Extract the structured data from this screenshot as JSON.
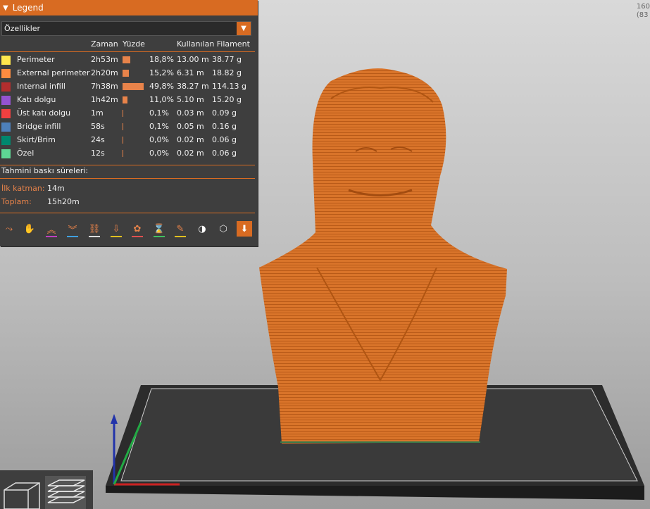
{
  "legend": {
    "title": "Legend",
    "view_select": "Özellikler",
    "columns": {
      "time": "Zaman",
      "percent": "Yüzde",
      "used": "Kullanılan Filament"
    },
    "rows": [
      {
        "name": "Perimeter",
        "color": "#ffe64d",
        "time": "2h53m",
        "percent": "18,8%",
        "pct": 18.8,
        "length": "13.00 m",
        "weight": "38.77 g"
      },
      {
        "name": "External perimeter",
        "color": "#ff8c40",
        "time": "2h20m",
        "percent": "15,2%",
        "pct": 15.2,
        "length": "6.31 m",
        "weight": "18.82 g"
      },
      {
        "name": "Internal infill",
        "color": "#b22e2e",
        "time": "7h38m",
        "percent": "49,8%",
        "pct": 49.8,
        "length": "38.27 m",
        "weight": "114.13 g"
      },
      {
        "name": "Katı dolgu",
        "color": "#9453d0",
        "time": "1h42m",
        "percent": "11,0%",
        "pct": 11.0,
        "length": "5.10 m",
        "weight": "15.20 g"
      },
      {
        "name": "Üst katı dolgu",
        "color": "#f04040",
        "time": "1m",
        "percent": "0,1%",
        "pct": 0.1,
        "length": "0.03 m",
        "weight": "0.09 g"
      },
      {
        "name": "Bridge infill",
        "color": "#4d80ba",
        "time": "58s",
        "percent": "0,1%",
        "pct": 0.1,
        "length": "0.05 m",
        "weight": "0.16 g"
      },
      {
        "name": "Skirt/Brim",
        "color": "#00876e",
        "time": "24s",
        "percent": "0,0%",
        "pct": 0.0,
        "length": "0.02 m",
        "weight": "0.06 g"
      },
      {
        "name": "Özel",
        "color": "#5ed694",
        "time": "12s",
        "percent": "0,0%",
        "pct": 0.0,
        "length": "0.02 m",
        "weight": "0.06 g"
      }
    ],
    "estimated_title": "Tahmini baskı süreleri:",
    "first_layer_label": "İlk katman:",
    "first_layer_value": "14m",
    "total_label": "Toplam:",
    "total_value": "15h20m"
  },
  "toolbar_icons": [
    "travel-icon",
    "wipe-icon",
    "retraction-icon",
    "deretraction-icon",
    "seams-icon",
    "tool-change-icon",
    "color-change-icon",
    "pause-icon",
    "custom-gcode-icon",
    "center-of-gravity-icon",
    "shells-icon",
    "tool-marker-icon"
  ],
  "coord_readout": [
    "160",
    "(83"
  ],
  "view_buttons": [
    "3d-view-icon",
    "layer-preview-icon"
  ],
  "colors": {
    "accent": "#d86b22",
    "model": "#d9742a",
    "panel": "#3e3e3e"
  }
}
